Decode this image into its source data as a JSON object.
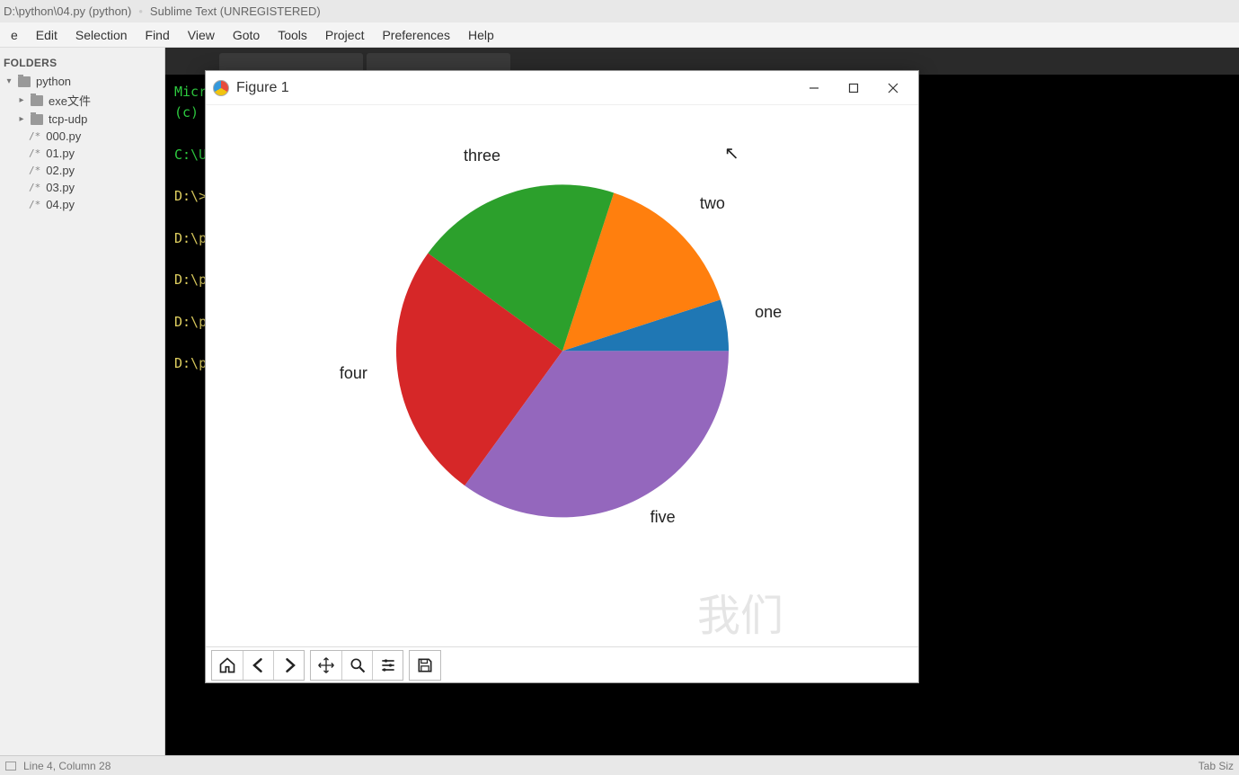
{
  "title_bar": {
    "path": "D:\\python\\04.py (python)",
    "app": "Sublime Text (UNREGISTERED)"
  },
  "menu": [
    "e",
    "Edit",
    "Selection",
    "Find",
    "View",
    "Goto",
    "Tools",
    "Project",
    "Preferences",
    "Help"
  ],
  "sidebar": {
    "header": "FOLDERS",
    "root": "python",
    "folders": [
      "exe文件",
      "tcp-udp"
    ],
    "files": [
      "000.py",
      "01.py",
      "02.py",
      "03.py",
      "04.py"
    ]
  },
  "terminal": {
    "lines": [
      {
        "cls": "g",
        "text": "Micr"
      },
      {
        "cls": "g",
        "text": "(c)"
      },
      {
        "cls": "",
        "text": ""
      },
      {
        "cls": "g",
        "text": "C:\\U"
      },
      {
        "cls": "",
        "text": ""
      },
      {
        "cls": "y",
        "text": "D:\\>"
      },
      {
        "cls": "",
        "text": ""
      },
      {
        "cls": "y",
        "text": "D:\\p"
      },
      {
        "cls": "",
        "text": ""
      },
      {
        "cls": "y",
        "text": "D:\\p"
      },
      {
        "cls": "",
        "text": ""
      },
      {
        "cls": "y",
        "text": "D:\\p"
      },
      {
        "cls": "",
        "text": ""
      },
      {
        "cls": "y",
        "text": "D:\\p"
      }
    ]
  },
  "figure": {
    "title": "Figure 1",
    "watermark": "我们"
  },
  "status": {
    "left": "Line 4, Column 28",
    "right": "Tab Siz"
  },
  "chart_data": {
    "type": "pie",
    "labels": [
      "one",
      "two",
      "three",
      "four",
      "five"
    ],
    "values": [
      5,
      15,
      20,
      25,
      35
    ],
    "colors": [
      "#1f77b4",
      "#ff7f0e",
      "#2ca02c",
      "#d62728",
      "#9467bd"
    ],
    "startangle": 0,
    "counterclockwise": true
  }
}
